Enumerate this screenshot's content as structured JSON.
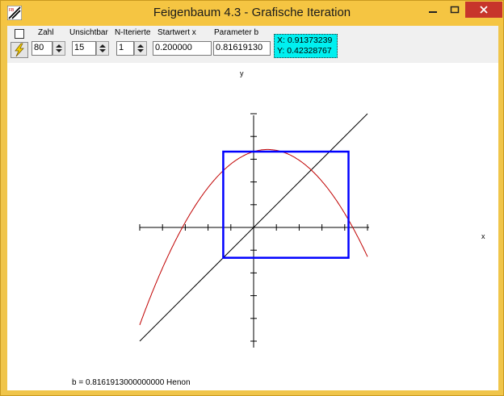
{
  "window": {
    "title": "Feigenbaum 4.3 - Grafische Iteration",
    "app_icon": "feigenbaum-app-icon",
    "controls": {
      "minimize": "minimize-icon",
      "maximize": "maximize-icon",
      "close": "close-icon"
    },
    "accent_color": "#f5c542",
    "close_color": "#c7352b"
  },
  "toolbar": {
    "checkbox_checked": false,
    "run_button_icon": "lightning-icon",
    "zahl": {
      "label": "Zahl",
      "value": "80"
    },
    "unsichtbar": {
      "label": "Unsichtbar",
      "value": "15"
    },
    "n_iterierte": {
      "label": "N-Iterierte",
      "value": "1"
    },
    "startwert": {
      "label": "Startwert x",
      "value": "0.200000"
    },
    "parameter": {
      "label": "Parameter b",
      "value": "0.81619130"
    },
    "cursor_x": "X: 0.91373239",
    "cursor_y": "Y: 0.42328767",
    "cursor_color": "#00f0f0"
  },
  "plot": {
    "x_axis_label": "x",
    "y_axis_label": "y",
    "status_text": "b = 0.8161913000000000  Henon"
  },
  "chart_data": {
    "type": "line",
    "grid": false,
    "xlim": [
      -1.5,
      1.5
    ],
    "ylim": [
      -1.5,
      1.5
    ],
    "series": [
      {
        "role": "diagonal",
        "function": "y = x",
        "color": "#000000"
      },
      {
        "role": "map",
        "function": "y = 1 - b*x^2 + 0.3*x",
        "parameter_b": 0.8161913,
        "color": "#c00000"
      },
      {
        "role": "cycle",
        "color": "#0000ff",
        "points": [
          [
            -0.4,
            1.0
          ],
          [
            1.25,
            1.0
          ],
          [
            1.25,
            -0.4
          ],
          [
            -0.4,
            -0.4
          ]
        ]
      }
    ]
  }
}
